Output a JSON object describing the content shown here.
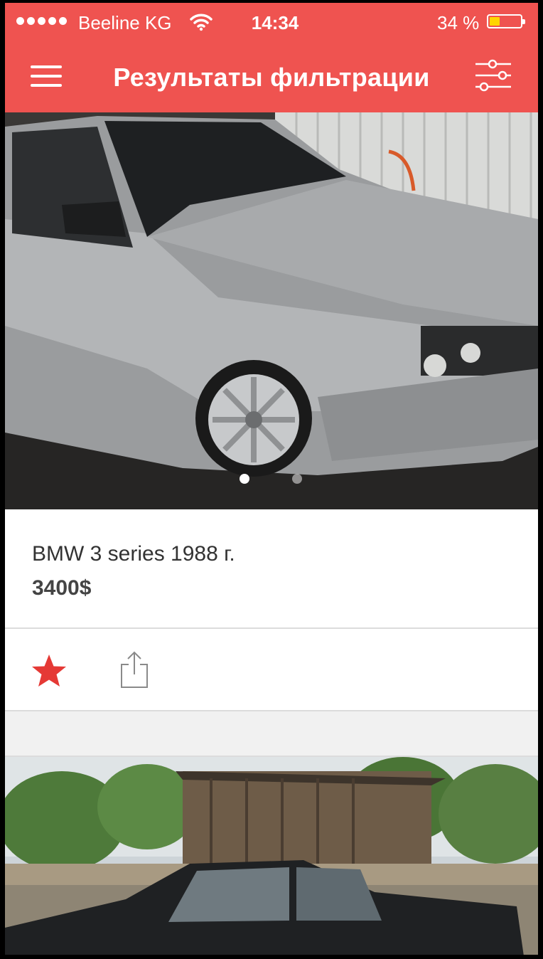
{
  "status_bar": {
    "carrier": "Beeline KG",
    "time": "14:34",
    "battery_percent": "34 %",
    "battery_level": 0.34
  },
  "nav_bar": {
    "title": "Результаты фильтрации",
    "menu_icon": "hamburger-menu-icon",
    "filter_icon": "sliders-filter-icon"
  },
  "listings": [
    {
      "title": "BMW 3 series 1988 г.",
      "price": "3400$",
      "photo_count": 2,
      "active_photo": 1,
      "favorite": true
    },
    {
      "title": "",
      "price": ""
    }
  ],
  "colors": {
    "accent": "#ef5350",
    "star": "#e53935",
    "battery": "#ffd600"
  }
}
